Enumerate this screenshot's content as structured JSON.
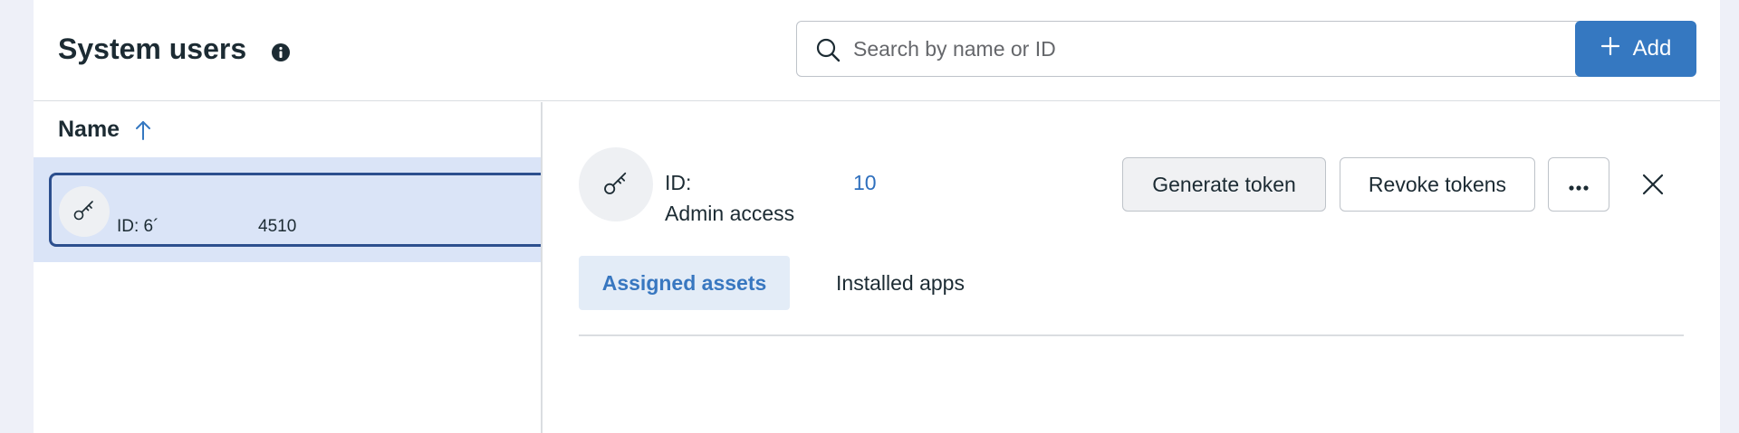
{
  "header": {
    "title": "System users",
    "search": {
      "placeholder": "Search by name or ID",
      "value": ""
    },
    "add_label": "Add"
  },
  "list": {
    "column_header": "Name",
    "sort_direction": "ascending",
    "selected_row": {
      "id_text": "ID: 6´",
      "id_suffix": "4510"
    }
  },
  "detail": {
    "id_label": "ID:",
    "id_value": "10",
    "access": "Admin access",
    "generate_token_label": "Generate token",
    "revoke_tokens_label": "Revoke tokens",
    "tabs": [
      {
        "label": "Assigned assets",
        "active": true
      },
      {
        "label": "Installed apps",
        "active": false
      }
    ]
  },
  "colors": {
    "accent": "#3578c1",
    "selected_row_bg": "#dae4f7",
    "selected_row_border": "#2c4f8e",
    "link": "#2e6fbd"
  },
  "icons": {
    "info": "info-icon",
    "search": "search-icon",
    "add": "plus-icon",
    "sort": "arrow-up-icon",
    "avatar": "key-icon",
    "more": "more-dots-icon",
    "close": "close-icon"
  }
}
